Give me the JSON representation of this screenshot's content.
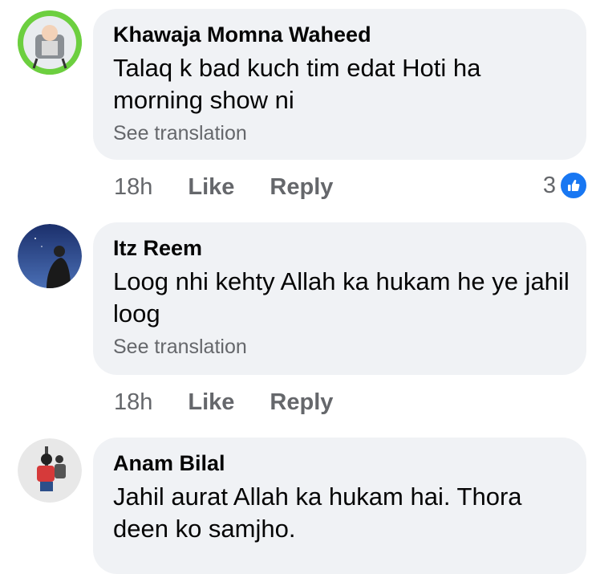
{
  "comments": [
    {
      "author": "Khawaja Momna Waheed",
      "text": "Talaq k bad kuch tim edat Hoti ha morning show ni",
      "see_translation": "See translation",
      "time": "18h",
      "like": "Like",
      "reply": "Reply",
      "reaction_count": "3"
    },
    {
      "author": "Itz Reem",
      "text": "Loog nhi kehty Allah ka hukam he ye jahil loog",
      "see_translation": "See translation",
      "time": "18h",
      "like": "Like",
      "reply": "Reply"
    },
    {
      "author": "Anam Bilal",
      "text": "Jahil aurat Allah ka hukam hai. Thora deen ko samjho."
    }
  ],
  "colors": {
    "bubble": "#f0f2f5",
    "secondary_text": "#65676b",
    "like_blue": "#1877f2"
  }
}
